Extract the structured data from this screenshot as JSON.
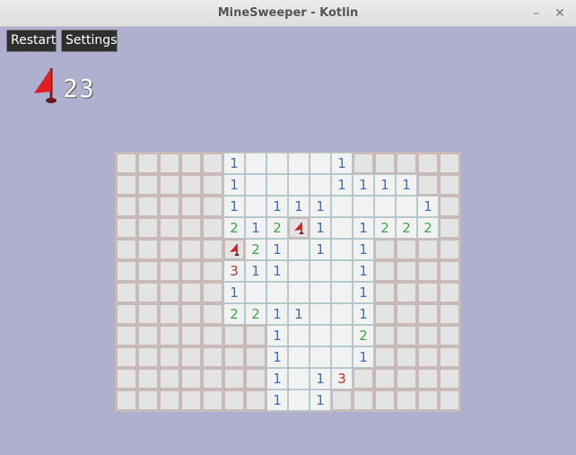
{
  "window": {
    "title": "MineSweeper - Kotlin"
  },
  "toolbar": {
    "restart_label": "Restart",
    "settings_label": "Settings"
  },
  "counter": {
    "icon": "flag-icon",
    "value": "23"
  },
  "colors": {
    "background": "#afafcf",
    "one": "#3a6fbf",
    "two": "#3aaa44",
    "three": "#c0302c"
  },
  "board": {
    "cols": 16,
    "rows_count": 12,
    "rows": [
      "#####1    1#####",
      "#####1    1111#",
      "#####1 111    1#",
      "#####212F1 1222#",
      "#####F21 1 1####",
      "#####311   1####",
      "#####1     1####",
      "#####2211  1####",
      "#######1   2####",
      "#######1   1####",
      "#######1 13#####",
      "#######1 1######"
    ]
  }
}
